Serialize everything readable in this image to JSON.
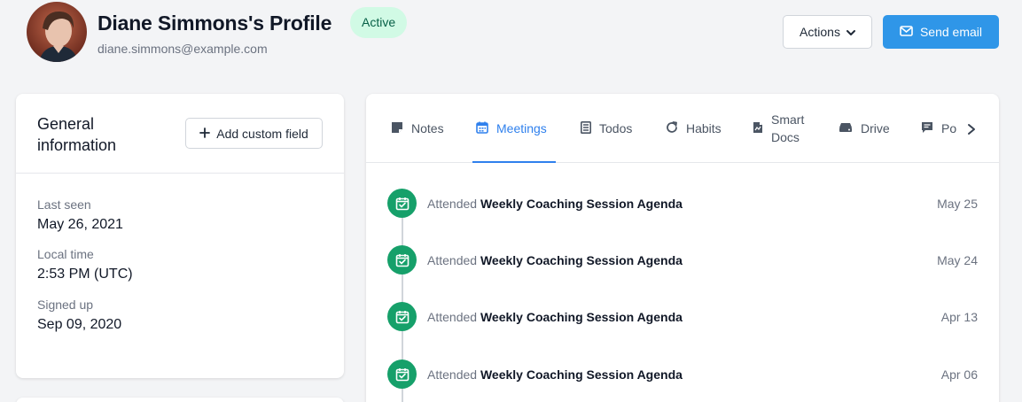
{
  "profile": {
    "name": "Diane Simmons's Profile",
    "status": "Active",
    "email": "diane.simmons@example.com"
  },
  "header_actions": {
    "actions_label": "Actions",
    "send_email_label": "Send email"
  },
  "general_info": {
    "title": "General information",
    "add_custom_field_label": "Add custom field",
    "fields": [
      {
        "label": "Last seen",
        "value": "May 26, 2021"
      },
      {
        "label": "Local time",
        "value": "2:53 PM (UTC)"
      },
      {
        "label": "Signed up",
        "value": "Sep 09, 2020"
      }
    ]
  },
  "tabs": [
    {
      "label": "Notes",
      "icon": "note-icon"
    },
    {
      "label": "Meetings",
      "icon": "calendar-icon",
      "active": true
    },
    {
      "label": "Todos",
      "icon": "checklist-icon"
    },
    {
      "label": "Habits",
      "icon": "refresh-icon"
    },
    {
      "label": "Smart Docs",
      "icon": "smart-doc-icon"
    },
    {
      "label": "Drive",
      "icon": "drive-icon"
    },
    {
      "label": "Po",
      "icon": "comment-icon"
    }
  ],
  "meetings": [
    {
      "verb": "Attended",
      "title": "Weekly Coaching Session Agenda",
      "date": "May 25"
    },
    {
      "verb": "Attended",
      "title": "Weekly Coaching Session Agenda",
      "date": "May 24"
    },
    {
      "verb": "Attended",
      "title": "Weekly Coaching Session Agenda",
      "date": "Apr 13"
    },
    {
      "verb": "Attended",
      "title": "Weekly Coaching Session Agenda",
      "date": "Apr 06"
    }
  ],
  "colors": {
    "primary": "#2f96e8",
    "active_tab": "#2f80ed",
    "status_bg": "#d1fae5",
    "status_text": "#065f46",
    "timeline_dot": "#16a06a"
  }
}
